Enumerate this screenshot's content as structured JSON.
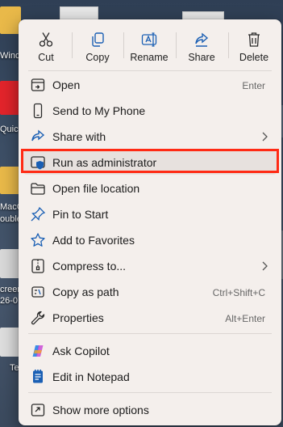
{
  "desktop": {
    "labels": [
      "Wind",
      "Quic",
      "MacC",
      "ouble",
      "creen",
      "26-0",
      "Te"
    ]
  },
  "toolbar": [
    {
      "label": "Cut",
      "icon": "scissors-icon"
    },
    {
      "label": "Copy",
      "icon": "copy-icon"
    },
    {
      "label": "Rename",
      "icon": "rename-icon"
    },
    {
      "label": "Share",
      "icon": "share-icon"
    },
    {
      "label": "Delete",
      "icon": "trash-icon"
    }
  ],
  "items": [
    {
      "label": "Open",
      "shortcut": "Enter",
      "icon": "open-icon"
    },
    {
      "label": "Send to My Phone",
      "icon": "phone-icon"
    },
    {
      "label": "Share with",
      "icon": "share-with-icon",
      "submenu": true
    },
    {
      "label": "Run as administrator",
      "icon": "shield-icon",
      "highlighted": true
    },
    {
      "label": "Open file location",
      "icon": "folder-icon"
    },
    {
      "label": "Pin to Start",
      "icon": "pin-icon"
    },
    {
      "label": "Add to Favorites",
      "icon": "star-icon"
    },
    {
      "label": "Compress to...",
      "icon": "compress-icon",
      "submenu": true
    },
    {
      "label": "Copy as path",
      "shortcut": "Ctrl+Shift+C",
      "icon": "copy-path-icon"
    },
    {
      "label": "Properties",
      "shortcut": "Alt+Enter",
      "icon": "wrench-icon"
    },
    {
      "label": "Ask Copilot",
      "icon": "copilot-icon"
    },
    {
      "label": "Edit in Notepad",
      "icon": "notepad-icon"
    },
    {
      "label": "Show more options",
      "icon": "more-options-icon"
    }
  ],
  "colors": {
    "highlight_border": "#ff2a14",
    "menu_bg": "#f4efec",
    "accent": "#1a5fb4"
  }
}
